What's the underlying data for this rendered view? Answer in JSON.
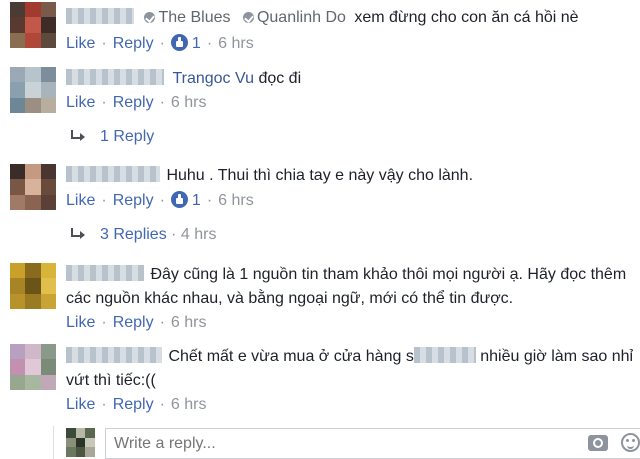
{
  "comments": [
    {
      "author": "",
      "tags": [
        "The Blues",
        "Quanlinh Do"
      ],
      "text": "xem đừng cho con ăn cá hồi nè",
      "like_label": "Like",
      "reply_label": "Reply",
      "like_count": "1",
      "time": "6 hrs"
    },
    {
      "author": "",
      "tagged_name": "Trangoc Vu",
      "text": "đọc đi",
      "like_label": "Like",
      "reply_label": "Reply",
      "time": "6 hrs",
      "replies_label": "1 Reply"
    },
    {
      "author": "",
      "text": "Huhu . Thui thì chia tay e này vậy cho lành.",
      "like_label": "Like",
      "reply_label": "Reply",
      "like_count": "1",
      "time": "6 hrs",
      "replies_label": "3 Replies",
      "replies_time": "4 hrs"
    },
    {
      "author": "",
      "text_line1": "Đây cũng là 1 nguồn tin tham khảo thôi mọi người ạ. Hãy đọc thêm",
      "text_line2": "các nguồn khác nhau, và bằng ngoại ngữ, mới có thể tin được.",
      "like_label": "Like",
      "reply_label": "Reply",
      "time": "6 hrs"
    },
    {
      "author": "",
      "text_line1a": "Chết mất e vừa mua ở cửa hàng s",
      "text_line1b": " nhiều giờ làm sao nhỉ",
      "text_line2": "vứt thì tiếc:((",
      "like_label": "Like",
      "reply_label": "Reply",
      "time": "6 hrs"
    }
  ],
  "reply_box": {
    "placeholder": "Write a reply..."
  },
  "colors": {
    "link": "#4267b2",
    "name": "#365899",
    "meta": "#90949c",
    "text": "#1d2129"
  },
  "icons": [
    "tag-icon",
    "like-reaction-icon",
    "reply-arrow-icon",
    "camera-icon",
    "emoji-icon"
  ]
}
